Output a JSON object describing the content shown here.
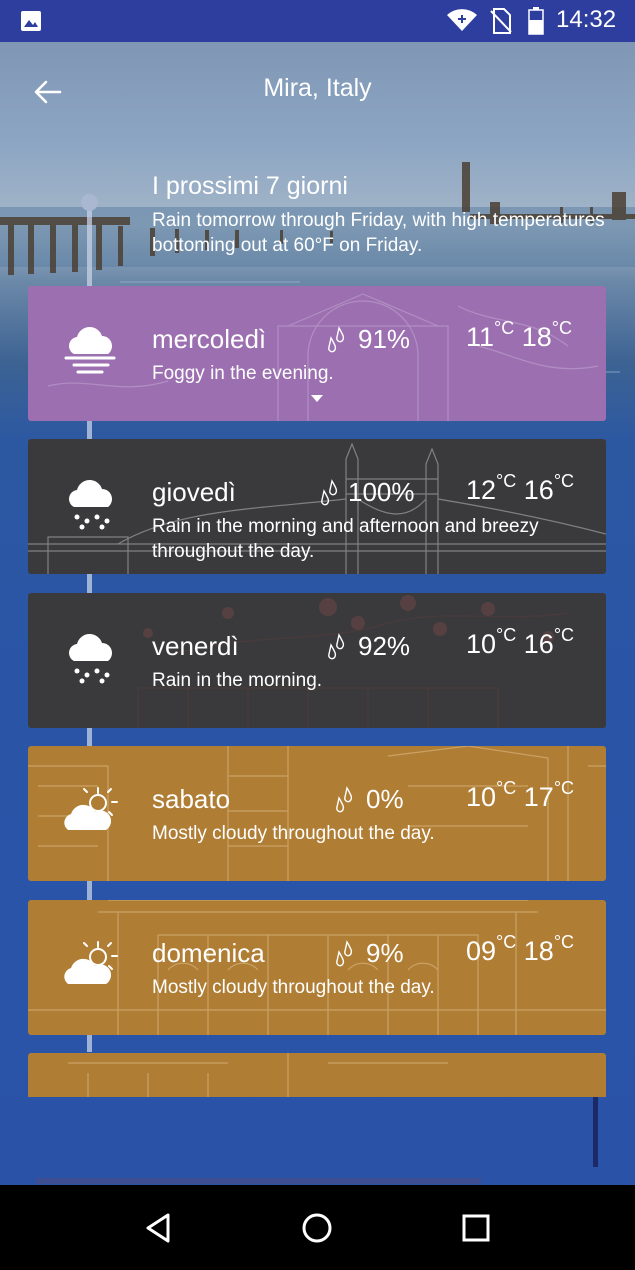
{
  "status_bar": {
    "time": "14:32",
    "icons": [
      "gallery-icon",
      "wifi-icon",
      "no-sim-icon",
      "battery-icon"
    ]
  },
  "header": {
    "back_icon": "arrow-left-icon",
    "title": "Mira, Italy"
  },
  "summary": {
    "title": "I prossimi 7 giorni",
    "text": "Rain tomorrow through Friday, with high temperatures bottoming out at 60°F on Friday."
  },
  "temp_unit": "°C",
  "days": [
    {
      "day": "mercoledì",
      "precip": "91%",
      "low": "11",
      "high": "18",
      "desc": "Foggy in the evening.",
      "icon": "fog-icon",
      "color": "#9c70b0",
      "expanded": true
    },
    {
      "day": "giovedì",
      "precip": "100%",
      "low": "12",
      "high": "16",
      "desc": "Rain in the morning and afternoon and breezy throughout the day.",
      "icon": "rain-icon",
      "color": "#3a3a3c"
    },
    {
      "day": "venerdì",
      "precip": "92%",
      "low": "10",
      "high": "16",
      "desc": "Rain in the morning.",
      "icon": "rain-icon",
      "color": "#3a3a3c"
    },
    {
      "day": "sabato",
      "precip": "0%",
      "low": "10",
      "high": "17",
      "desc": "Mostly cloudy throughout the day.",
      "icon": "partly-cloudy-icon",
      "color": "#b07d34"
    },
    {
      "day": "domenica",
      "precip": "9%",
      "low": "09",
      "high": "18",
      "desc": "Mostly cloudy throughout the day.",
      "icon": "partly-cloudy-icon",
      "color": "#b07d34"
    }
  ],
  "partial_card_color": "#b07d34",
  "nav_bar": {
    "icons": [
      "back-triangle-icon",
      "home-circle-icon",
      "recents-square-icon"
    ]
  }
}
